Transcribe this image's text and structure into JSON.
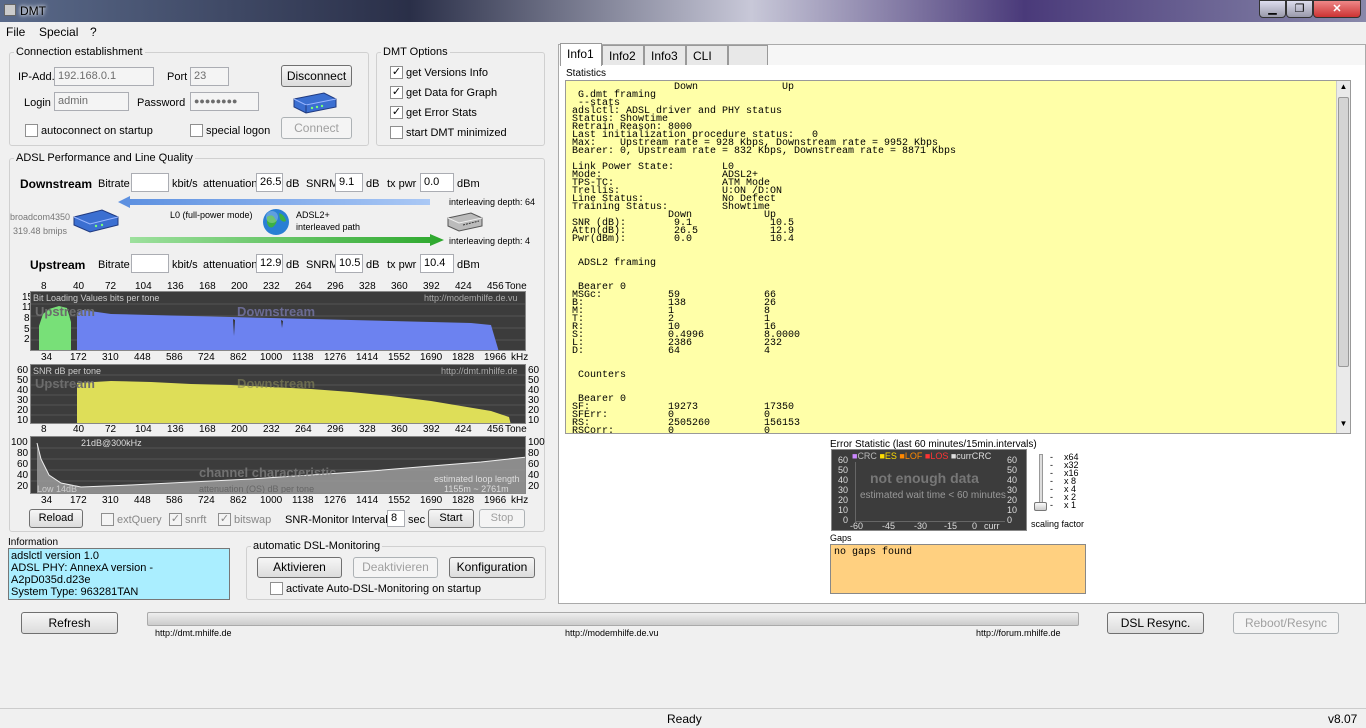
{
  "window": {
    "title": "DMT",
    "min": "▁",
    "max": "❐",
    "close": "✕"
  },
  "menu": [
    "File",
    "Special",
    "?"
  ],
  "connection": {
    "legend": "Connection establishment",
    "ip_label": "IP-Add.",
    "ip": "192.168.0.1",
    "port_label": "Port",
    "port": "23",
    "login_label": "Login",
    "login": "admin",
    "password_label": "Password",
    "password": "●●●●●●●●",
    "disconnect": "Disconnect",
    "connect": "Connect",
    "autoconnect": "autoconnect on startup",
    "special_logon": "special logon"
  },
  "dmt_options": {
    "legend": "DMT Options",
    "items": [
      {
        "label": "get Versions Info",
        "checked": "✓"
      },
      {
        "label": "get Data for Graph",
        "checked": "✓"
      },
      {
        "label": "get Error Stats",
        "checked": "✓"
      },
      {
        "label": "start DMT minimized",
        "checked": ""
      }
    ]
  },
  "adsl": {
    "legend": "ADSL Performance and Line Quality",
    "downstream": "Downstream",
    "upstream": "Upstream",
    "bitrate": "Bitrate",
    "kbits": "kbit/s",
    "attenuation": "attenuation",
    "db": "dB",
    "snrm": "SNRM",
    "txpwr": "tx pwr",
    "dbm": "dBm",
    "down_bitrate": "",
    "down_att": "26.5",
    "down_snrm": "9.1",
    "down_txpwr": "0.0",
    "up_bitrate": "",
    "up_att": "12.9",
    "up_snrm": "10.5",
    "up_txpwr": "10.4",
    "modem_name": "broadcom4350",
    "modem_speed": "319.48 bmips",
    "power_mode": "L0 (full-power mode)",
    "mode": "ADSL2+",
    "path": "interleaved path",
    "il_depth_down": "interleaving depth: 64",
    "il_depth_up": "interleaving depth: 4"
  },
  "charts": {
    "bits_title": "Bit Loading Values   bits per tone",
    "bits_url": "http://modemhilfe.de.vu",
    "bits_y": [
      "15",
      "11",
      "8",
      "5",
      "2",
      "0"
    ],
    "snr_title": "SNR  dB per tone",
    "snr_url": "http://dmt.mhilfe.de",
    "snr_y": [
      "60",
      "50",
      "40",
      "30",
      "20",
      "10",
      "0"
    ],
    "ch_title": "21dB@300kHz",
    "ch_y": [
      "100",
      "80",
      "60",
      "40",
      "20"
    ],
    "ch_low": "Low 14dB",
    "ch_att": "attenuation (OS)  dB per tone",
    "ch_loop": "estimated loop length",
    "ch_loop_val": "1155m ~ 2761m",
    "ch_watermark": "channel characteristic",
    "upstream_wm": "Upstream",
    "downstream_wm": "Downstream",
    "tone_top": [
      "8",
      "40",
      "72",
      "104",
      "136",
      "168",
      "200",
      "232",
      "264",
      "296",
      "328",
      "360",
      "392",
      "424",
      "456",
      "Tone"
    ],
    "khz_axis": [
      "34",
      "172",
      "310",
      "448",
      "586",
      "724",
      "862",
      "1000",
      "1138",
      "1276",
      "1414",
      "1552",
      "1690",
      "1828",
      "1966",
      "kHz"
    ]
  },
  "controls": {
    "reload": "Reload",
    "extquery": "extQuery",
    "snrft": "snrft",
    "bitswap": "bitswap",
    "snr_interval_label": "SNR-Monitor Interval:",
    "snr_interval": "8",
    "sec": "sec",
    "start": "Start",
    "stop": "Stop"
  },
  "information": {
    "legend": "Information",
    "lines": [
      "adslctl version 1.0",
      "ADSL PHY: AnnexA version - A2pD035d.d23e",
      "System Type: 963281TAN"
    ]
  },
  "monitoring": {
    "legend": "automatic DSL-Monitoring",
    "activate": "Aktivieren",
    "deactivate": "Deaktivieren",
    "config": "Konfiguration",
    "startup": "activate Auto-DSL-Monitoring on startup"
  },
  "tabs": [
    "Info1",
    "Info2",
    "Info3",
    "CLI"
  ],
  "statistics_label": "Statistics",
  "stats_text": "                 Down              Up\n G.dmt framing\n --stats\nadslctl: ADSL driver and PHY status\nStatus: Showtime\nRetrain Reason: 8000\nLast initialization procedure status:   0\nMax:    Upstream rate = 928 Kbps, Downstream rate = 9952 Kbps\nBearer: 0, Upstream rate = 832 Kbps, Downstream rate = 8871 Kbps\n\nLink Power State:        L0\nMode:                    ADSL2+\nTPS-TC:                  ATM Mode\nTrellis:                 U:ON /D:ON\nLine Status:             No Defect\nTraining Status:         Showtime\n                Down            Up\nSNR (dB):        9.1             10.5\nAttn(dB):        26.5            12.9\nPwr(dBm):        0.0             10.4\n\n\n ADSL2 framing\n\n\n Bearer 0\nMSGc:           59              66\nB:              138             26\nM:              1               8\nT:              2               1\nR:              10              16\nS:              0.4996          8.0000\nL:              2386            232\nD:              64              4\n\n\n Counters\n\n\n Bearer 0\nSF:             19273           17350\nSFErr:          0               0\nRS:             2505260         156153\nRSCorr:         0               0",
  "error_stat": {
    "title": "Error Statistic (last 60 minutes/15min.intervals)",
    "legend": [
      "CRC",
      "ES",
      "LOF",
      "LOS",
      "currCRC"
    ],
    "legend_colors": [
      "#cc88ff",
      "#ffdd00",
      "#ff8800",
      "#ff3333",
      "#dddddd"
    ],
    "y": [
      "60",
      "50",
      "40",
      "30",
      "20",
      "10",
      "0"
    ],
    "x": [
      "-60",
      "-45",
      "-30",
      "-15",
      "0",
      "curr"
    ],
    "msg1": "not enough data",
    "msg2": "estimated wait time < 60 minutes",
    "scale": [
      "x64",
      "x32",
      "x16",
      "x 8",
      "x 4",
      "x 2",
      "x 1"
    ],
    "scale_label": "scaling factor"
  },
  "gaps": {
    "label": "Gaps",
    "text": "no gaps found"
  },
  "bottom": {
    "refresh": "Refresh",
    "dsl_resync": "DSL Resync.",
    "reboot": "Reboot/Resync",
    "link1": "http://dmt.mhilfe.de",
    "link2": "http://modemhilfe.de.vu",
    "link3": "http://forum.mhilfe.de"
  },
  "status": {
    "text": "Ready",
    "version": "v8.07"
  }
}
